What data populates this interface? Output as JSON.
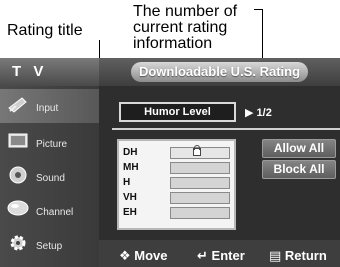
{
  "annotations": {
    "rating_title": "Rating title",
    "current_rating_info": [
      "The number of",
      "current rating",
      "information"
    ]
  },
  "header": {
    "tv_label": "T V",
    "title": "Downloadable U.S. Rating"
  },
  "sidebar": {
    "items": [
      {
        "label": "Input",
        "icon": "input-icon"
      },
      {
        "label": "Picture",
        "icon": "picture-icon"
      },
      {
        "label": "Sound",
        "icon": "sound-icon"
      },
      {
        "label": "Channel",
        "icon": "channel-icon"
      },
      {
        "label": "Setup",
        "icon": "setup-icon"
      }
    ]
  },
  "main": {
    "rating_title": "Humor Level",
    "page_indicator": "1/2",
    "rows": [
      "DH",
      "MH",
      "H",
      "VH",
      "EH"
    ],
    "allow_all": "Allow All",
    "block_all": "Block All"
  },
  "footer": {
    "move": "Move",
    "enter": "Enter",
    "return": "Return"
  }
}
